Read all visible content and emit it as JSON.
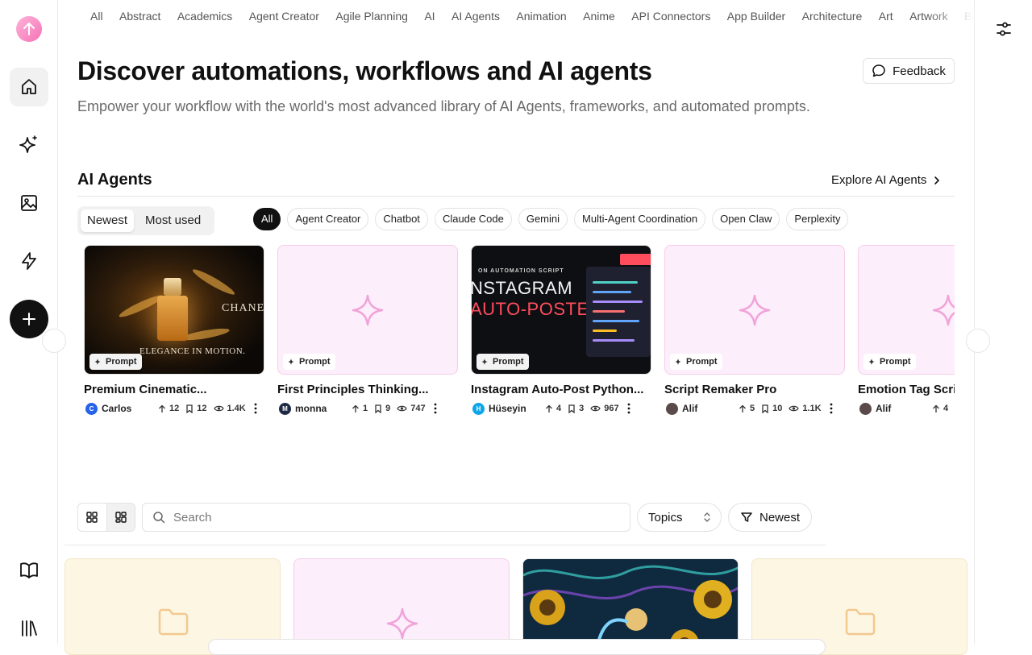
{
  "topics": [
    "All",
    "Abstract",
    "Academics",
    "Agent Creator",
    "Agile Planning",
    "AI",
    "AI Agents",
    "Animation",
    "Anime",
    "API Connectors",
    "App Builder",
    "Architecture",
    "Art",
    "Artwork",
    "Books"
  ],
  "hero": {
    "title": "Discover automations, workflows and AI agents",
    "subtitle": "Empower your workflow with the world's most advanced library of AI Agents, frameworks, and automated prompts.",
    "feedback_label": "Feedback"
  },
  "section": {
    "title": "AI Agents",
    "explore_label": "Explore AI Agents"
  },
  "sort": {
    "newest": "Newest",
    "most_used": "Most used",
    "selected": "Newest"
  },
  "chips": [
    "All",
    "Agent Creator",
    "Chatbot",
    "Claude Code",
    "Gemini",
    "Multi-Agent Coordination",
    "Open Claw",
    "Perplexity"
  ],
  "selected_chip": "All",
  "cards": [
    {
      "title": "Premium Cinematic...",
      "badge": "Prompt",
      "author": "Carlos",
      "avatar_letter": "C",
      "avatar_color": "#2563eb",
      "upvotes": "12",
      "saves": "12",
      "views": "1.4K",
      "thumb_text_1": "CHANEL",
      "thumb_text_2": "ELEGANCE IN MOTION."
    },
    {
      "title": "First Principles Thinking...",
      "badge": "Prompt",
      "author": "monna",
      "avatar_letter": "M",
      "avatar_color": "#1e2a44",
      "upvotes": "1",
      "saves": "9",
      "views": "747"
    },
    {
      "title": "Instagram Auto-Post Python...",
      "badge": "Prompt",
      "author": "Hüseyin",
      "avatar_letter": "H",
      "avatar_color": "#0ea5e9",
      "upvotes": "4",
      "saves": "3",
      "views": "967",
      "thumb_text_1": "ON AUTOMATION SCRIPT",
      "thumb_text_2": "NSTAGRAM",
      "thumb_text_3": "AUTO-POSTER"
    },
    {
      "title": "Script Remaker Pro",
      "badge": "Prompt",
      "author": "Alif",
      "avatar_letter": "",
      "avatar_color": "#5b4a4a",
      "upvotes": "5",
      "saves": "10",
      "views": "1.1K"
    },
    {
      "title": "Emotion Tag Script",
      "badge": "Prompt",
      "author": "Alif",
      "avatar_letter": "",
      "avatar_color": "#5b4a4a",
      "upvotes": "4",
      "saves": "",
      "views": ""
    }
  ],
  "toolbar": {
    "search_placeholder": "Search",
    "topics_label": "Topics",
    "newest_label": "Newest"
  },
  "colors": {
    "accent_pink": "#f472b6",
    "sparkle": "#f0a3d8",
    "folder": "#f2c98f",
    "dark": "#111111"
  }
}
